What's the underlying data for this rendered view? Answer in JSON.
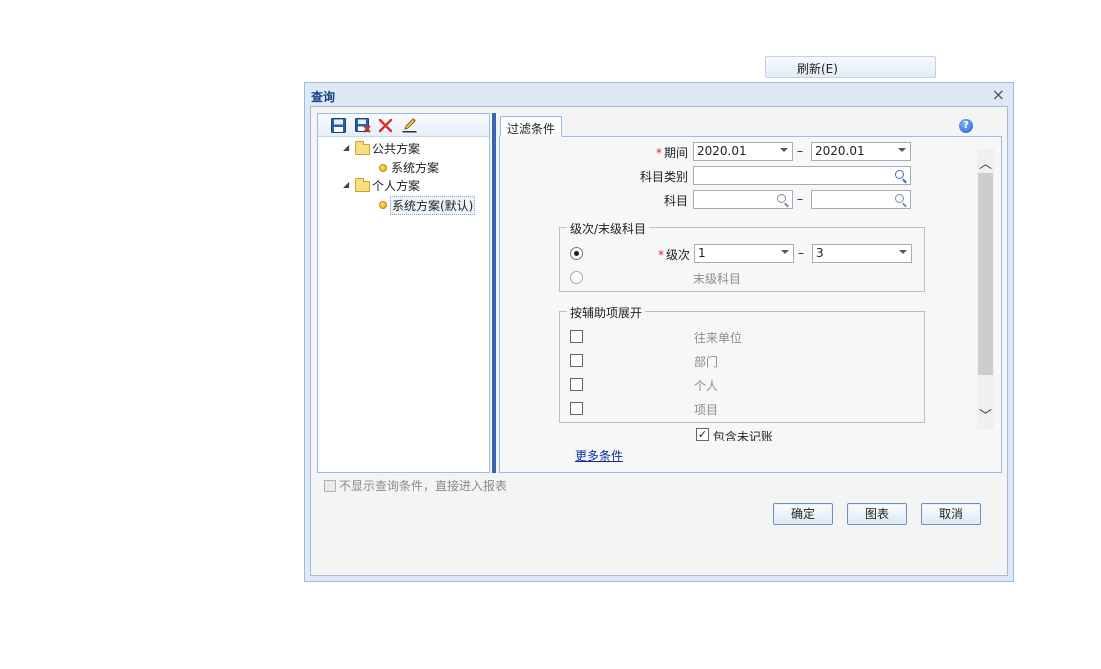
{
  "toolbar_top": {
    "refresh_label": "刷新(E)"
  },
  "dialog": {
    "title": "查询",
    "close_glyph": "×"
  },
  "tree": {
    "toolbar_icons": [
      "save-icon",
      "save-as-icon",
      "delete-icon",
      "edit-icon"
    ],
    "nodes": [
      {
        "label": "公共方案",
        "type": "folder"
      },
      {
        "label": "系统方案",
        "type": "leaf"
      },
      {
        "label": "个人方案",
        "type": "folder"
      },
      {
        "label": "系统方案(默认)",
        "type": "leaf",
        "selected": true
      }
    ]
  },
  "tab": {
    "label": "过滤条件"
  },
  "help_glyph": "?",
  "form": {
    "period_label": "期间",
    "period_from": "2020.01",
    "period_to": "2020.01",
    "subject_type_label": "科目类别",
    "subject_type_value": "",
    "subject_label": "科目",
    "subject_from": "",
    "subject_to": "",
    "range_dash": "–",
    "required_mark": "*"
  },
  "level_group": {
    "title": "级次/末级科目",
    "level_label": "级次",
    "level_from": "1",
    "level_to": "3",
    "leaf_label": "末级科目",
    "selected": "level"
  },
  "aux_group": {
    "title": "按辅助项展开",
    "items": [
      "往来单位",
      "部门",
      "个人",
      "项目"
    ]
  },
  "include_unposted_label": "包含未记账",
  "more_conditions_link": "更多条件",
  "no_show_label": "不显示查询条件，直接进入报表",
  "buttons": {
    "ok": "确定",
    "chart": "图表",
    "cancel": "取消"
  },
  "scroll_glyphs": {
    "up": "︿",
    "down": "﹀"
  },
  "colors": {
    "required": "#e0262b",
    "link": "#0e2d9e",
    "border": "#99bbe8",
    "splitter": "#3a64b4"
  }
}
